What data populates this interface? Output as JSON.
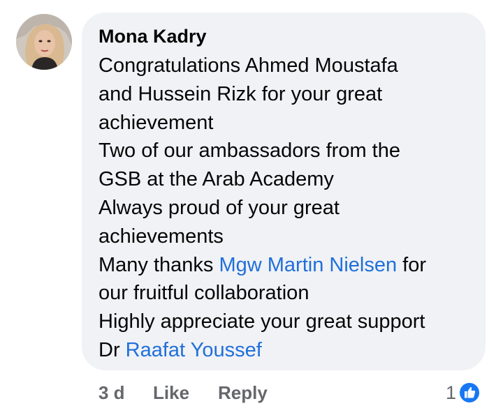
{
  "comment": {
    "author": "Mona Kadry",
    "avatar_icon": "profile-photo",
    "body": {
      "line1": "Congratulations Ahmed Moustafa",
      "line2": "and Hussein Rizk for your great",
      "line3": "achievement",
      "line4": "Two of our ambassadors from the",
      "line5": "GSB at the Arab Academy",
      "line6": "Always proud of your great",
      "line7": "achievements",
      "line8_prefix": "Many thanks ",
      "mention1": "Mgw Martin Nielsen",
      "line8_suffix": " for",
      "line9": "our fruitful collaboration",
      "line10": "Highly appreciate your great support",
      "line11_prefix": "Dr ",
      "mention2": "Raafat Youssef"
    }
  },
  "actions": {
    "time": "3 d",
    "like": "Like",
    "reply": "Reply"
  },
  "reactions": {
    "count": "1",
    "icon": "like-icon"
  },
  "colors": {
    "bubble_bg": "#f0f2f5",
    "mention": "#216fdb",
    "meta_text": "#65676b",
    "like_blue": "#1877f2"
  }
}
